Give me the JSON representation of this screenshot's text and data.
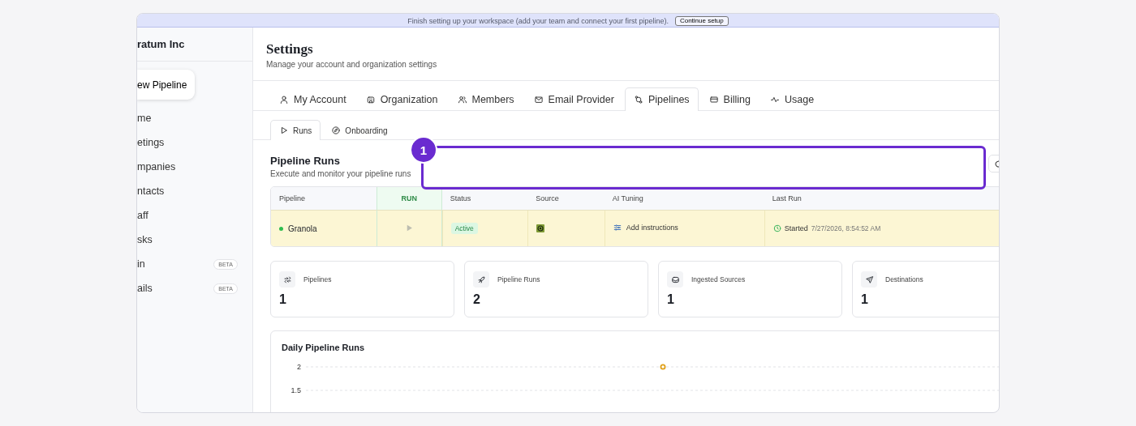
{
  "banner": {
    "text": "Finish setting up your workspace (add your team and connect your first pipeline).",
    "button": "Continue setup"
  },
  "sidebar": {
    "org_name": "ratum Inc",
    "new_button": "ew Pipeline",
    "items": [
      {
        "label": "me"
      },
      {
        "label": "etings"
      },
      {
        "label": "mpanies"
      },
      {
        "label": "ntacts"
      },
      {
        "label": "aff"
      },
      {
        "label": "sks"
      },
      {
        "label": "in",
        "badge": "BETA"
      },
      {
        "label": "ails",
        "badge": "BETA"
      }
    ]
  },
  "header": {
    "title": "Settings",
    "subtitle": "Manage your account and organization settings"
  },
  "tabs": [
    {
      "label": "My Account",
      "selected": false
    },
    {
      "label": "Organization",
      "selected": false
    },
    {
      "label": "Members",
      "selected": false
    },
    {
      "label": "Email Provider",
      "selected": false
    },
    {
      "label": "Pipelines",
      "selected": true
    },
    {
      "label": "Billing",
      "selected": false
    },
    {
      "label": "Usage",
      "selected": false
    }
  ],
  "subtabs": [
    {
      "label": "Runs",
      "selected": true
    },
    {
      "label": "Onboarding",
      "selected": false
    }
  ],
  "section": {
    "title": "Pipeline Runs",
    "subtitle": "Execute and monitor your pipeline runs"
  },
  "annotation": {
    "number": "1"
  },
  "table": {
    "columns": [
      "Pipeline",
      "RUN",
      "Status",
      "Source",
      "AI Tuning",
      "Last Run"
    ],
    "rows": [
      {
        "pipeline": "Granola",
        "status": "Active",
        "ai_tuning": "Add instructions",
        "last_run_label": "Started",
        "last_run_time": "7/27/2026, 8:54:52 AM",
        "selected": true
      }
    ]
  },
  "stats": [
    {
      "label": "Pipelines",
      "value": "1"
    },
    {
      "label": "Pipeline Runs",
      "value": "2"
    },
    {
      "label": "Ingested Sources",
      "value": "1"
    },
    {
      "label": "Destinations",
      "value": "1"
    }
  ],
  "chart": {
    "chart_data": {
      "type": "line",
      "title": "Daily Pipeline Runs",
      "ylim": [
        1.5,
        2
      ],
      "yticks": [
        1.5,
        2
      ],
      "series": [
        {
          "color": "#e0a11b",
          "marker": "o",
          "values": [
            2
          ]
        }
      ]
    }
  }
}
